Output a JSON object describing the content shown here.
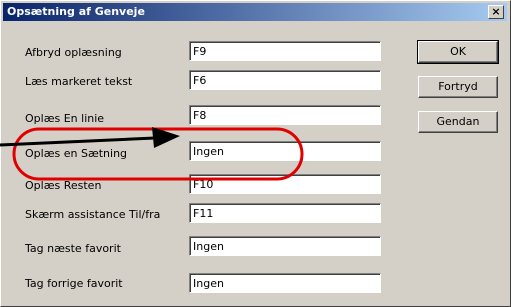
{
  "window": {
    "title": "Opsætning af Genveje",
    "close_glyph": "×"
  },
  "rows": [
    {
      "label": "Afbryd oplæsning",
      "value": "F9"
    },
    {
      "label": "Læs markeret tekst",
      "value": "F6"
    },
    {
      "label": "Oplæs En linie",
      "value": "F8"
    },
    {
      "label": "Oplæs en Sætning",
      "value": "Ingen"
    },
    {
      "label": "Oplæs Resten",
      "value": "F10"
    },
    {
      "label": "Skærm assistance Til/fra",
      "value": "F11"
    },
    {
      "label": "Tag næste favorit",
      "value": "Ingen"
    },
    {
      "label": "Tag forrige favorit",
      "value": "Ingen"
    }
  ],
  "buttons": {
    "ok": "OK",
    "cancel": "Fortryd",
    "restore": "Gendan"
  },
  "colors": {
    "annotation_red": "#e00000",
    "arrow": "#000000"
  }
}
